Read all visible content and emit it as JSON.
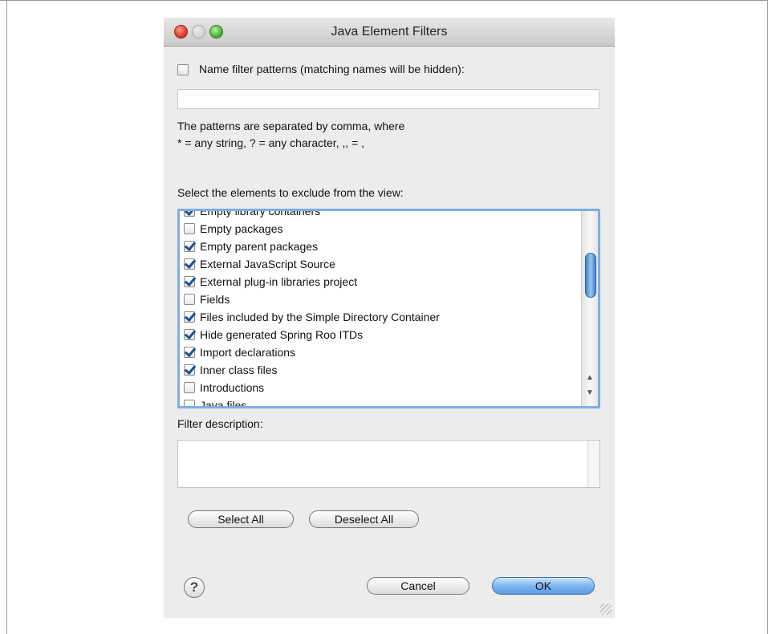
{
  "window": {
    "title": "Java Element Filters"
  },
  "name_filter": {
    "label": "Name filter patterns (matching names will be hidden):",
    "checked": false,
    "value": "",
    "help_line1": "The patterns are separated by comma, where",
    "help_line2": "* = any string, ? = any character, ,, = ,"
  },
  "elements": {
    "label": "Select the elements to exclude from the view:",
    "items": [
      {
        "label": "Empty library containers",
        "checked": true
      },
      {
        "label": "Empty packages",
        "checked": false
      },
      {
        "label": "Empty parent packages",
        "checked": true
      },
      {
        "label": "External JavaScript Source",
        "checked": true
      },
      {
        "label": "External plug-in libraries project",
        "checked": true
      },
      {
        "label": "Fields",
        "checked": false
      },
      {
        "label": "Files included by the Simple Directory Container",
        "checked": true
      },
      {
        "label": "Hide generated Spring Roo ITDs",
        "checked": true
      },
      {
        "label": "Import declarations",
        "checked": true
      },
      {
        "label": "Inner class files",
        "checked": true
      },
      {
        "label": "Introductions",
        "checked": false
      },
      {
        "label": "Java files",
        "checked": false
      }
    ]
  },
  "description": {
    "label": "Filter description:",
    "value": ""
  },
  "buttons": {
    "select_all": "Select All",
    "deselect_all": "Deselect All",
    "cancel": "Cancel",
    "ok": "OK",
    "help": "?"
  },
  "colors": {
    "focus_ring": "#7eaee3",
    "ok_button": "#5a9de3",
    "check": "#1c4f99"
  },
  "icons": {
    "help": "question-mark-icon",
    "close": "close-traffic-light",
    "minimize": "minimize-traffic-light",
    "zoom": "zoom-traffic-light"
  }
}
